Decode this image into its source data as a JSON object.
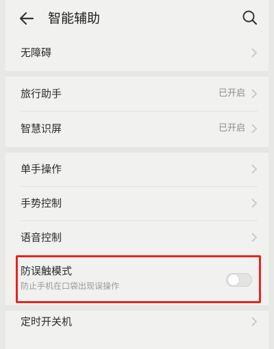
{
  "header": {
    "title": "智能辅助"
  },
  "rows": [
    {
      "label": "无障碍"
    },
    {
      "label": "旅行助手",
      "value": "已开启"
    },
    {
      "label": "智慧识屏",
      "value": "已开启"
    },
    {
      "label": "单手操作"
    },
    {
      "label": "手势控制"
    },
    {
      "label": "语音控制"
    },
    {
      "label": "防误触模式",
      "subtitle": "防止手机在口袋出现误操作",
      "toggle": false
    },
    {
      "label": "定时开关机"
    }
  ],
  "colors": {
    "highlight": "#e8231f",
    "background": "#f1f1f0"
  },
  "icons": {
    "back": "back-arrow-icon",
    "search": "search-icon",
    "chevron": "chevron-right-icon"
  }
}
